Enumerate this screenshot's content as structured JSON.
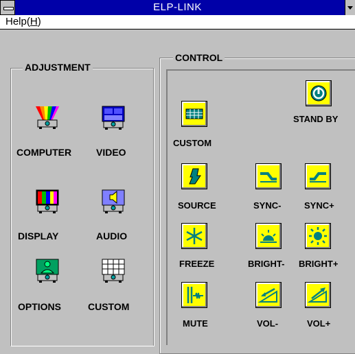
{
  "window": {
    "title": "ELP-LINK"
  },
  "menu": {
    "help": "Help(H)",
    "help_prefix": "Help(",
    "help_key": "H",
    "help_suffix": ")"
  },
  "adjustment": {
    "legend": "ADJUSTMENT",
    "items": [
      {
        "label": "COMPUTER",
        "icon": "computer-projector-icon"
      },
      {
        "label": "VIDEO",
        "icon": "video-projector-icon"
      },
      {
        "label": "DISPLAY",
        "icon": "display-projector-icon"
      },
      {
        "label": "AUDIO",
        "icon": "audio-projector-icon"
      },
      {
        "label": "OPTIONS",
        "icon": "options-projector-icon"
      },
      {
        "label": "CUSTOM",
        "icon": "custom-projector-icon"
      }
    ]
  },
  "control": {
    "legend": "CONTROL",
    "items": [
      {
        "label": "CUSTOM",
        "icon": "custom-grid-icon"
      },
      {
        "label": "STAND BY",
        "icon": "power-icon"
      },
      {
        "label": "SOURCE",
        "icon": "source-icon"
      },
      {
        "label": "SYNC-",
        "icon": "sync-minus-icon"
      },
      {
        "label": "SYNC+",
        "icon": "sync-plus-icon"
      },
      {
        "label": "FREEZE",
        "icon": "freeze-icon"
      },
      {
        "label": "BRIGHT-",
        "icon": "bright-minus-icon"
      },
      {
        "label": "BRIGHT+",
        "icon": "bright-plus-icon"
      },
      {
        "label": "MUTE",
        "icon": "mute-icon"
      },
      {
        "label": "VOL-",
        "icon": "volume-minus-icon"
      },
      {
        "label": "VOL+",
        "icon": "volume-plus-icon"
      }
    ]
  }
}
